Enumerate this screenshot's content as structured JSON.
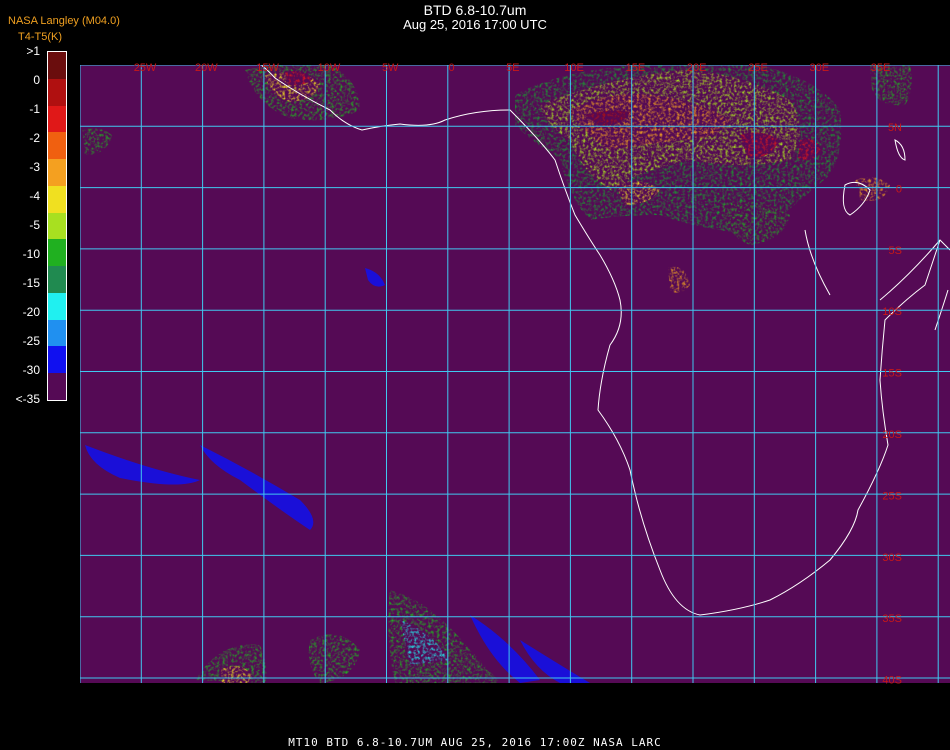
{
  "header": {
    "title": "BTD 6.8-10.7um",
    "subtitle": "Aug 25, 2016 17:00 UTC",
    "credit": "NASA Langley (M04.0)",
    "legend_label": "T4-T5(K)"
  },
  "legend": {
    "labels": [
      ">1",
      "0",
      "-1",
      "-2",
      "-3",
      "-4",
      "-5",
      "-10",
      "-15",
      "-20",
      "-25",
      "-30",
      "<-35"
    ],
    "colors": [
      "#6a0d0d",
      "#b01010",
      "#e01818",
      "#f06010",
      "#f4a020",
      "#f0e020",
      "#a8e020",
      "#20b020",
      "#208a50",
      "#20f0f0",
      "#2090f0",
      "#1010f0",
      "#550a55"
    ]
  },
  "map": {
    "background_color": "#550a55",
    "grid_color": "#40c8f0",
    "label_color": "#c81818",
    "lon_labels": [
      "25W",
      "20W",
      "15W",
      "10W",
      "5W",
      "0",
      "5E",
      "10E",
      "15E",
      "20E",
      "25E",
      "30E",
      "35E"
    ],
    "lat_labels": [
      "5N",
      "0",
      "5S",
      "10S",
      "15S",
      "20S",
      "25S",
      "30S",
      "35S",
      "40S"
    ]
  },
  "footer": {
    "text": "MT10  BTD 6.8-10.7UM   AUG 25, 2016 17:00Z   NASA LARC"
  }
}
